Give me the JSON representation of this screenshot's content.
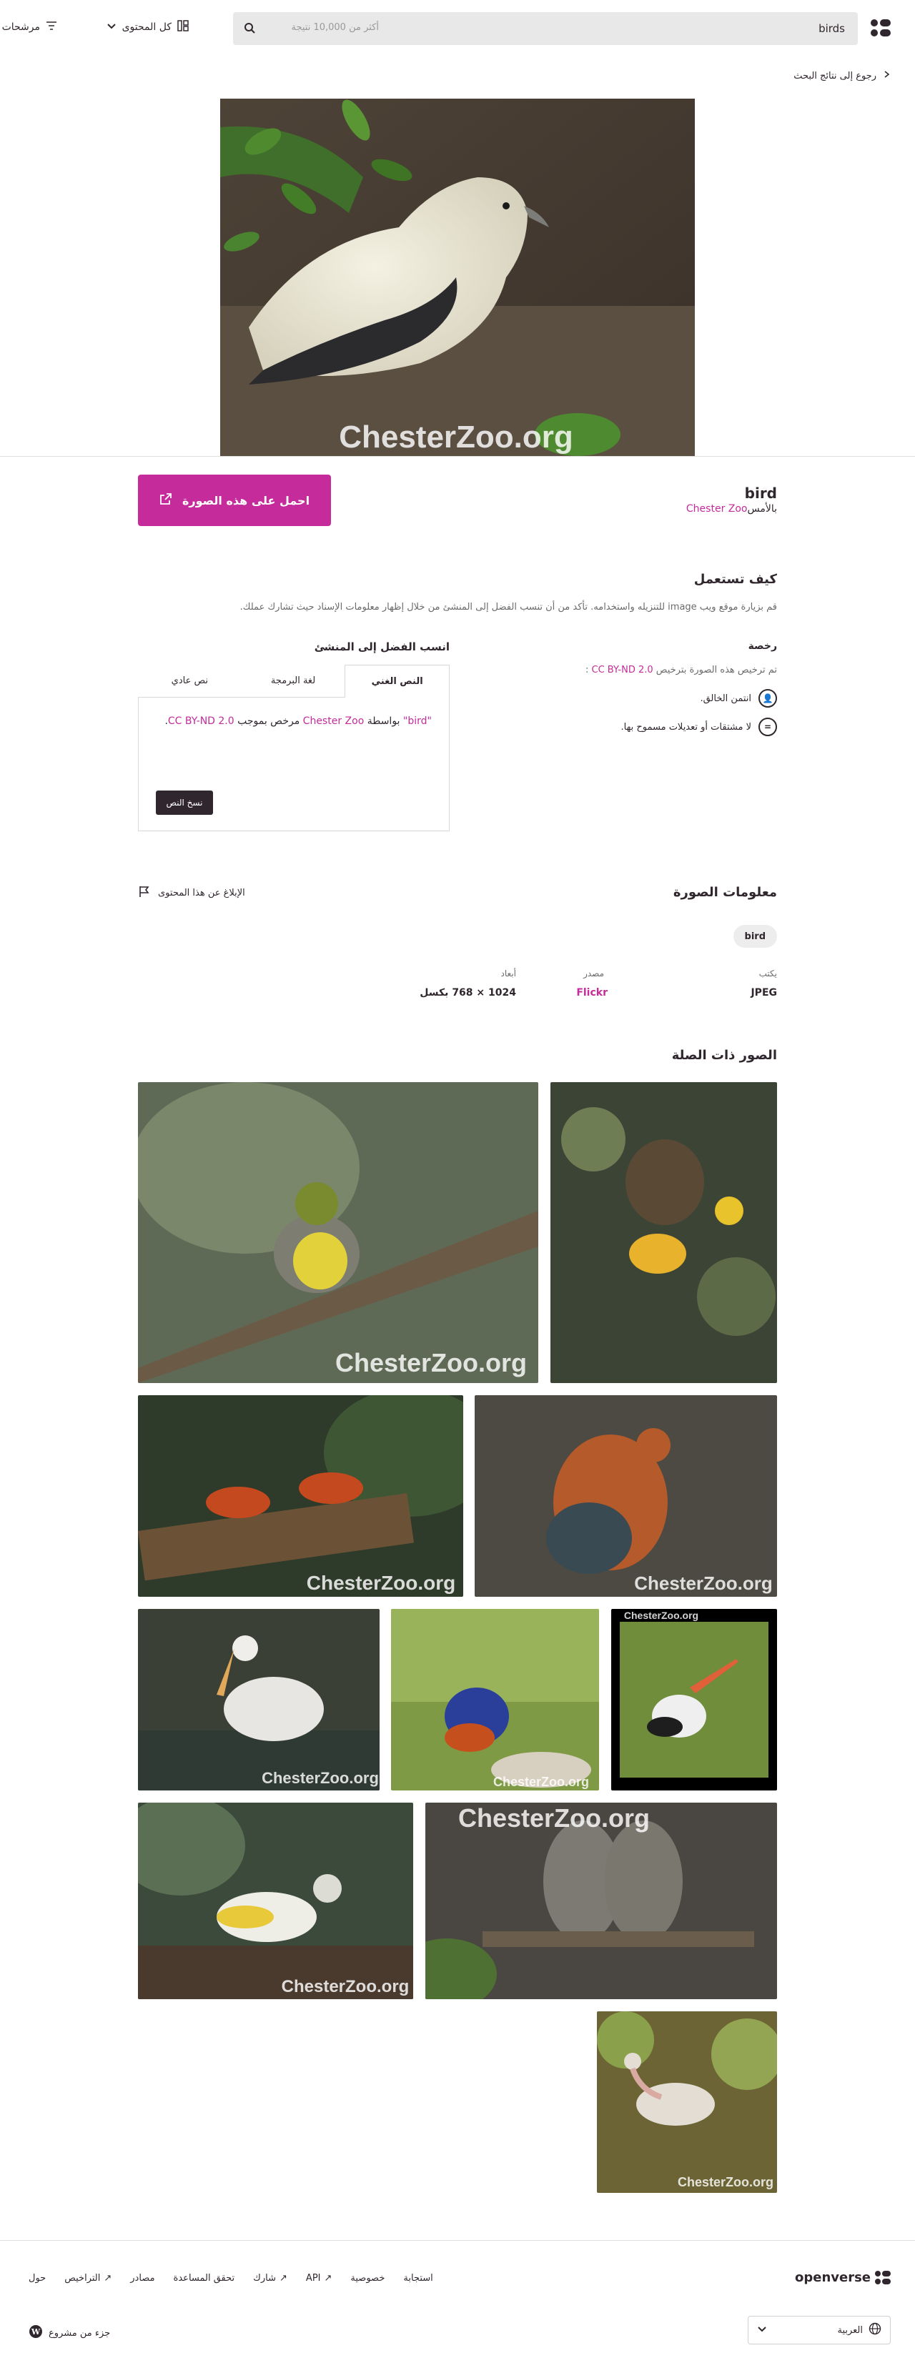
{
  "header": {
    "logo_name": "openverse-logo-icon",
    "search_term": "birds",
    "search_count": "أكثر من 10,000 نتيجة",
    "content_type": "كل المحتوى",
    "filters": "مرشحات"
  },
  "nav": {
    "back": "رجوع إلى نتائج البحث"
  },
  "image": {
    "title": "bird",
    "by": "بالأمس",
    "creator": "Chester Zoo",
    "watermark": "ChesterZoo.org",
    "use_button": "احمل على هذه الصورة"
  },
  "reuse": {
    "heading": "كيف تستعمل",
    "description": "قم بزيارة موقع ويب image للتنزيله واستخدامه. تأكد من أن تنسب الفضل إلى المنشئ من خلال إظهار معلومات الإسناد حيث تشارك عملك.",
    "license_heading": "رخصة",
    "license_prefix": "تم ترخيص هذه الصورة بترخيص",
    "license_name": "CC BY-ND 2.0",
    "license_suffix": ":",
    "items": [
      {
        "icon": "by-icon",
        "text": "انتمن الخالق."
      },
      {
        "icon": "nd-icon",
        "text": "لا مشتقات أو تعديلات مسموح بها."
      }
    ],
    "attribution_heading": "انسب الفضل إلى المنشئ",
    "tabs": [
      "النص الغني",
      "لغة البرمجة",
      "نص عادي"
    ],
    "attribution": {
      "title": "\"bird\"",
      "by": " بواسطة ",
      "creator": "Chester Zoo",
      "license_prefix": " مرخص بموجب ",
      "license": "CC BY-ND 2.0",
      "end": "."
    },
    "copy_button": "نسخ النص"
  },
  "info": {
    "heading": "معلومات الصورة",
    "report": "الإبلاغ عن هذا المحتوى",
    "tags": [
      "bird"
    ],
    "fields": [
      {
        "label": "يكتب",
        "value": "JPEG"
      },
      {
        "label": "مصدر",
        "value": "Flickr"
      },
      {
        "label": "أبعاد",
        "value": "1024 × 768 بكسل"
      }
    ]
  },
  "related": {
    "heading": "الصور ذات الصلة",
    "watermark": "ChesterZoo.org"
  },
  "footer": {
    "logo": "openverse",
    "nav": [
      "حول",
      "التراخيص",
      "مصادر",
      "تحقق المساعدة",
      "شارك",
      "API",
      "خصوصية",
      "استجابة"
    ],
    "language": "العربية",
    "wordpress": "جزء من مشروع"
  },
  "colors": {
    "accent": "#c52b9b",
    "text": "#30272e",
    "tag_bg": "#ededed"
  }
}
